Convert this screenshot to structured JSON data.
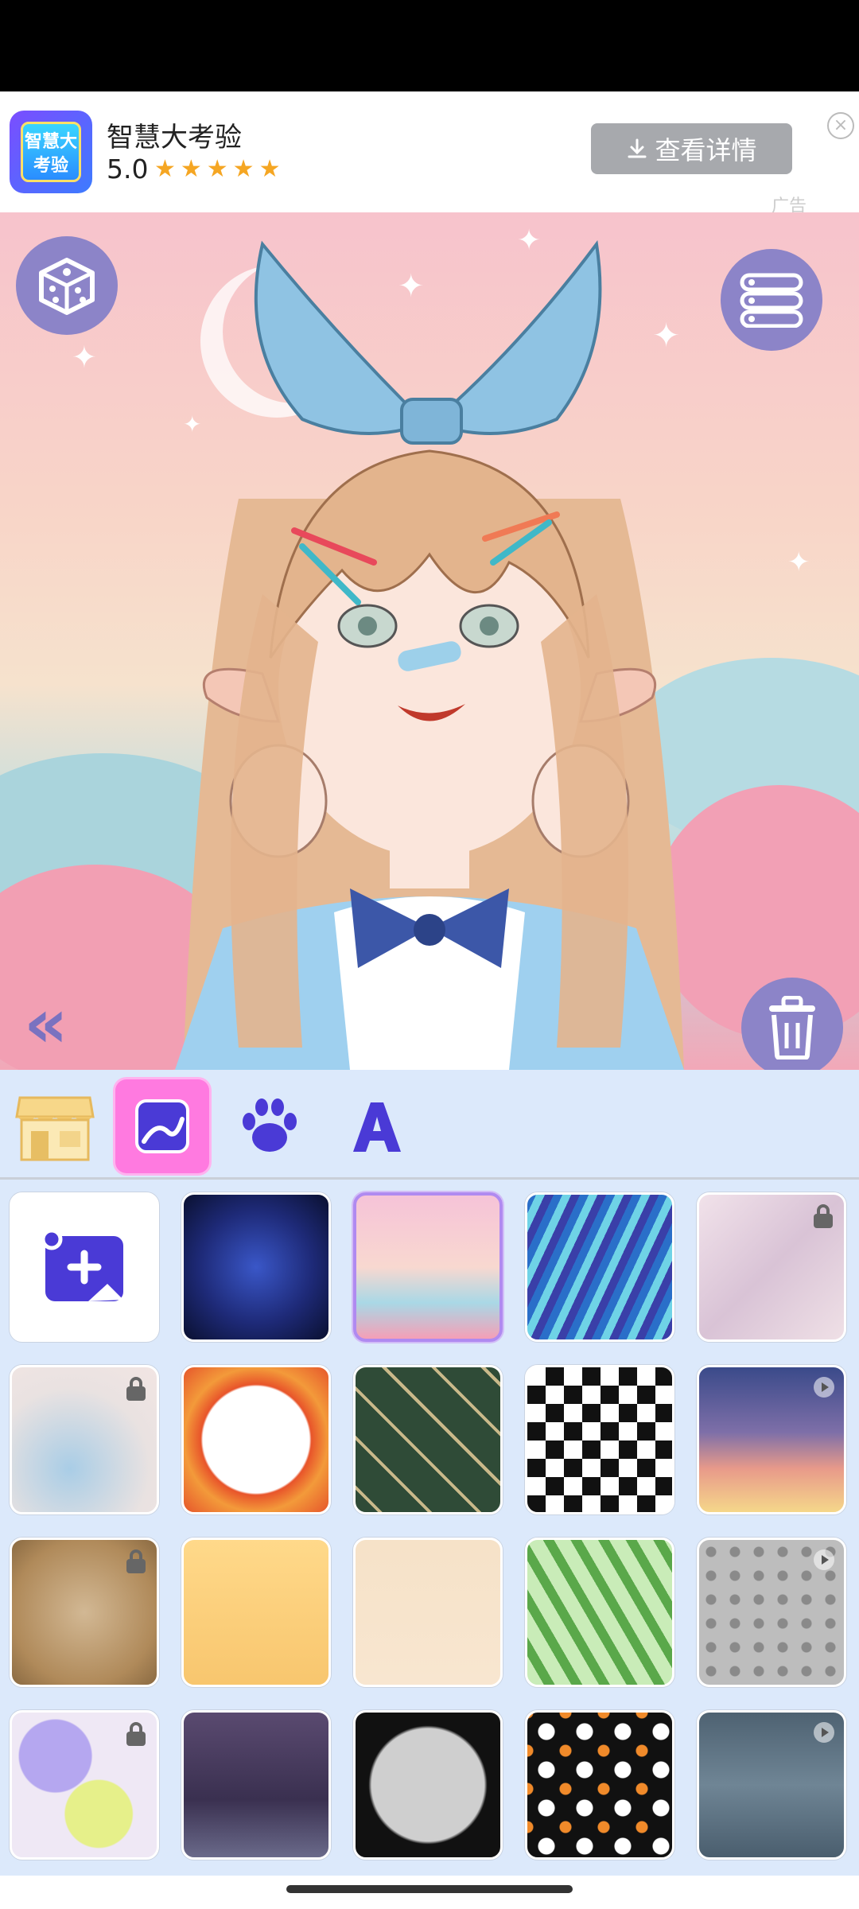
{
  "ad": {
    "logo_text": "智慧大考验",
    "title": "智慧大考验",
    "rating": "5.0",
    "stars": "★★★★★",
    "cta_label": "查看详情",
    "ad_label": "广告"
  },
  "canvas": {
    "dice_icon": "dice-icon",
    "menu_icon": "list-menu-icon",
    "back_icon": "double-chevron-left-icon",
    "trash_icon": "trash-icon"
  },
  "tabs": [
    {
      "icon": "storefront-icon",
      "active": false
    },
    {
      "icon": "background-image-icon",
      "active": true
    },
    {
      "icon": "paw-icon",
      "active": false
    },
    {
      "icon": "letter-a-icon",
      "active": false
    }
  ],
  "backgrounds": [
    {
      "name": "add-custom-image",
      "locked": false,
      "video": false
    },
    {
      "name": "galaxy-planet",
      "locked": false,
      "video": false
    },
    {
      "name": "pastel-clouds-stars",
      "locked": false,
      "video": false,
      "selected": true
    },
    {
      "name": "blue-swirl",
      "locked": false,
      "video": false
    },
    {
      "name": "pink-marble",
      "locked": true,
      "video": false
    },
    {
      "name": "watercolor-blue",
      "locked": true,
      "video": false
    },
    {
      "name": "orange-mandala-frame",
      "locked": false,
      "video": false
    },
    {
      "name": "green-geometric",
      "locked": false,
      "video": false
    },
    {
      "name": "checkerboard",
      "locked": false,
      "video": false
    },
    {
      "name": "sunset-sky",
      "locked": false,
      "video": true
    },
    {
      "name": "old-paper",
      "locked": true,
      "video": false
    },
    {
      "name": "golden-wings",
      "locked": false,
      "video": false
    },
    {
      "name": "floral-border",
      "locked": false,
      "video": false
    },
    {
      "name": "green-leaves",
      "locked": false,
      "video": false
    },
    {
      "name": "skull-pattern",
      "locked": false,
      "video": true
    },
    {
      "name": "paint-splash",
      "locked": true,
      "video": false
    },
    {
      "name": "night-lake",
      "locked": false,
      "video": false
    },
    {
      "name": "halloween-frame",
      "locked": false,
      "video": false
    },
    {
      "name": "ghost-pattern",
      "locked": false,
      "video": false
    },
    {
      "name": "night-clouds-moon",
      "locked": false,
      "video": true
    }
  ],
  "colors": {
    "accent": "#8c84c8",
    "active_tab": "#ff7ae0",
    "panel_bg": "#dce9fb",
    "selected_border": "#b08af0"
  }
}
